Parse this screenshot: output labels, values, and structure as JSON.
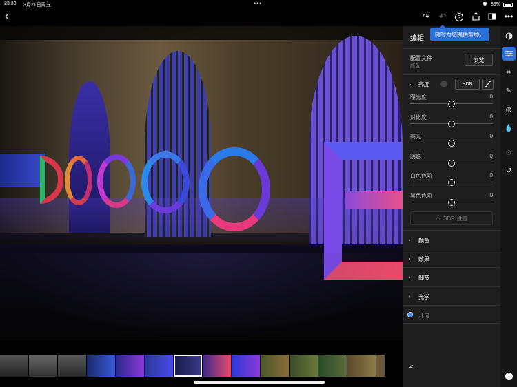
{
  "status_bar": {
    "time": "23:38",
    "date": "3月21日周五",
    "battery": "89%"
  },
  "toolbar": {
    "tooltip": "随时为您提供帮助。"
  },
  "panel": {
    "title": "编辑",
    "profile": {
      "label": "配置文件",
      "value": "颜色",
      "browse": "浏览"
    },
    "light": {
      "label": "亮度",
      "hdr": "HDR",
      "sliders": [
        {
          "name": "曝光度",
          "value": "0"
        },
        {
          "name": "对比度",
          "value": "0"
        },
        {
          "name": "高光",
          "value": "0"
        },
        {
          "name": "阴影",
          "value": "0"
        },
        {
          "name": "白色色阶",
          "value": "0"
        },
        {
          "name": "黑色色阶",
          "value": "0"
        }
      ],
      "sdr": "SDR 设置"
    },
    "sections": [
      {
        "label": "颜色"
      },
      {
        "label": "效果"
      },
      {
        "label": "细节"
      },
      {
        "label": "光学"
      },
      {
        "label": "几何"
      }
    ]
  },
  "colors": {
    "accent": "#2c6fd6",
    "panel_bg": "#1e1e1e",
    "rail_bg": "#161616"
  },
  "icons": [
    "chevron-left-icon",
    "redo-icon",
    "undo-icon",
    "help-icon",
    "share-icon",
    "compare-icon",
    "more-icon",
    "presets-icon",
    "edit-sliders-icon",
    "crop-icon",
    "heal-icon",
    "masking-icon",
    "color-icon",
    "versions-icon",
    "history-icon",
    "info-icon"
  ]
}
